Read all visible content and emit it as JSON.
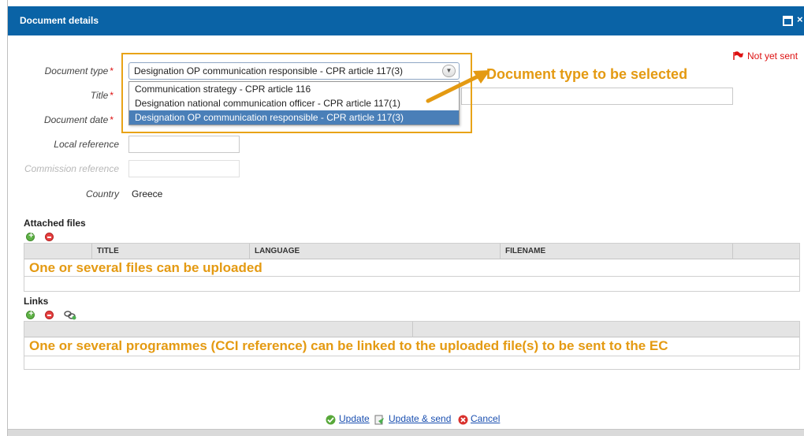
{
  "window": {
    "title": "Document details",
    "close_label": "×"
  },
  "status": {
    "text": "Not yet sent",
    "color": "#d11111"
  },
  "form": {
    "document_type": {
      "label": "Document type",
      "value": "Designation OP communication responsible - CPR article 117(3)",
      "options": [
        "Communication strategy - CPR article 116",
        "Designation national communication officer - CPR article 117(1)",
        "Designation OP communication responsible - CPR article 117(3)"
      ],
      "selected_index": 2
    },
    "title": {
      "label": "Title",
      "value": ""
    },
    "document_date": {
      "label": "Document date",
      "value": ""
    },
    "local_reference": {
      "label": "Local reference",
      "value": ""
    },
    "commission_reference": {
      "label": "Commission reference",
      "value": ""
    },
    "country": {
      "label": "Country",
      "value": "Greece"
    },
    "required_marker": "*"
  },
  "annotations": {
    "doc_type": "Document type to be selected",
    "files": "One or several files can be uploaded",
    "links": "One or several programmes (CCI reference) can be linked to the uploaded file(s) to be sent to the EC",
    "color": "#e49a12"
  },
  "attached_files": {
    "title": "Attached files",
    "columns": [
      "",
      "TITLE",
      "LANGUAGE",
      "FILENAME",
      ""
    ]
  },
  "links": {
    "title": "Links",
    "columns": [
      "",
      ""
    ]
  },
  "footer": {
    "update": "Update",
    "update_send": "Update & send",
    "cancel": "Cancel"
  },
  "colors": {
    "titlebar": "#0a63a6",
    "highlight_border": "#e8a317",
    "selected_option": "#4a7fb8",
    "link": "#1a4fb0"
  }
}
